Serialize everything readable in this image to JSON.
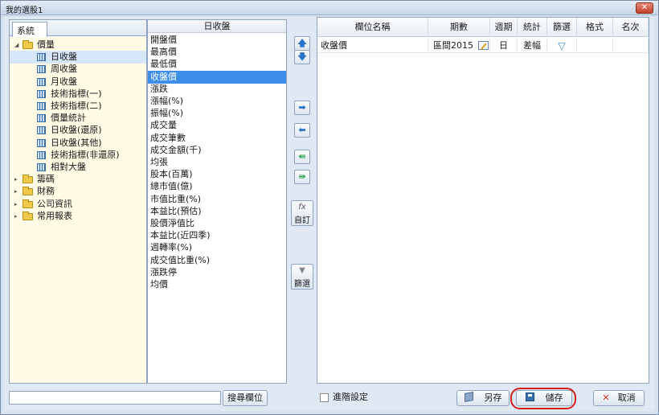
{
  "window": {
    "title": "我的選股1",
    "close_glyph": "✕"
  },
  "tree": {
    "tab_label": "系統",
    "nodes": [
      {
        "label": "價量",
        "type": "folder",
        "expanded": true,
        "level": 0
      },
      {
        "label": "日收盤",
        "type": "item",
        "level": 1,
        "selected": true
      },
      {
        "label": "周收盤",
        "type": "item",
        "level": 1
      },
      {
        "label": "月收盤",
        "type": "item",
        "level": 1
      },
      {
        "label": "技術指標(一)",
        "type": "item",
        "level": 1
      },
      {
        "label": "技術指標(二)",
        "type": "item",
        "level": 1
      },
      {
        "label": "價量統計",
        "type": "item",
        "level": 1
      },
      {
        "label": "日收盤(還原)",
        "type": "item",
        "level": 1
      },
      {
        "label": "日收盤(其他)",
        "type": "item",
        "level": 1
      },
      {
        "label": "技術指標(非還原)",
        "type": "item",
        "level": 1
      },
      {
        "label": "相對大盤",
        "type": "item",
        "level": 1
      },
      {
        "label": "籌碼",
        "type": "folder",
        "expanded": false,
        "level": 0
      },
      {
        "label": "財務",
        "type": "folder",
        "expanded": false,
        "level": 0
      },
      {
        "label": "公司資訊",
        "type": "folder",
        "expanded": false,
        "level": 0
      },
      {
        "label": "常用報表",
        "type": "folder",
        "expanded": false,
        "level": 0
      }
    ]
  },
  "field_list": {
    "header": "日收盤",
    "selected_index": 3,
    "items": [
      "開盤價",
      "最高價",
      "最低價",
      "收盤價",
      "漲跌",
      "漲幅(%)",
      "振幅(%)",
      "成交量",
      "成交筆數",
      "成交金額(千)",
      "均張",
      "股本(百萬)",
      "總市值(億)",
      "市值比重(%)",
      "本益比(預估)",
      "股價淨值比",
      "本益比(近四季)",
      "週轉率(%)",
      "成交值比重(%)",
      "漲跌停",
      "均價"
    ]
  },
  "middle_buttons": {
    "up": "🡅",
    "down": "🡇",
    "add": "➡",
    "remove": "⬅",
    "remove_all": "⇚",
    "add_all": "⇛",
    "custom_icon": "fx",
    "custom_label": "自訂",
    "filter_icon": "▼",
    "filter_label": "篩選"
  },
  "grid": {
    "columns": [
      "欄位名稱",
      "期數",
      "週期",
      "統計",
      "篩選",
      "格式",
      "名次"
    ],
    "rows": [
      {
        "name": "收盤價",
        "period": "區間2015",
        "cycle": "日",
        "stat": "差幅",
        "filter_icon": "▽",
        "format": "",
        "rank": ""
      }
    ]
  },
  "bottom": {
    "search_placeholder": "",
    "search_value": "",
    "search_button": "搜尋欄位",
    "advanced_label": "進階設定",
    "advanced_checked": false,
    "save_as_label": "另存",
    "save_label": "儲存",
    "cancel_label": "取消",
    "cancel_glyph": "✕"
  },
  "colors": {
    "selection": "#3d8ee8",
    "highlight_ring": "#d0201a",
    "tree_bg": "#fffbe5"
  }
}
